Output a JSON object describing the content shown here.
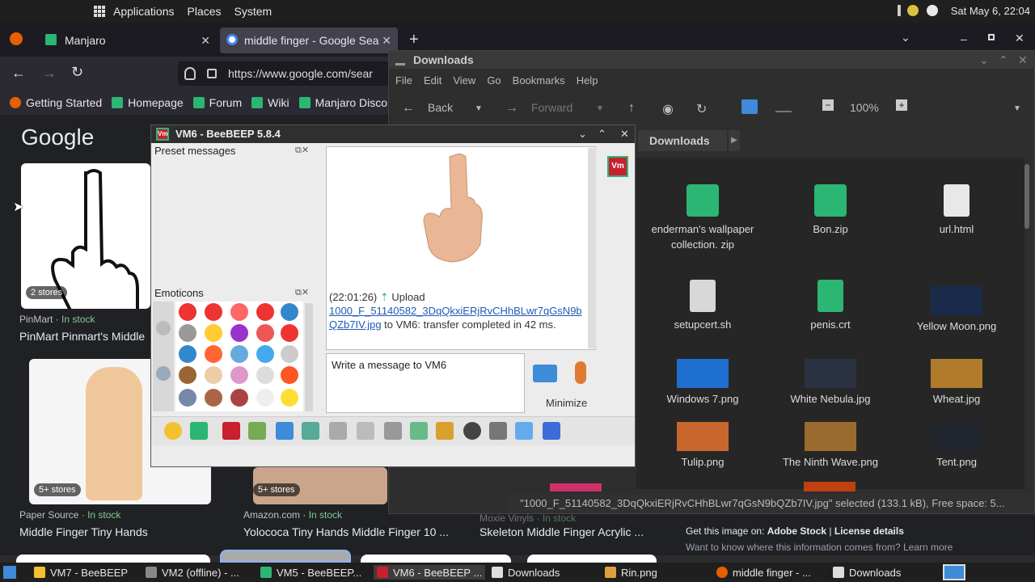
{
  "top_panel": {
    "menus": [
      "Applications",
      "Places",
      "System"
    ],
    "clock": "Sat May 6, 22:04"
  },
  "firefox": {
    "tabs": [
      {
        "label": "Manjaro"
      },
      {
        "label": "middle finger - Google Sea"
      }
    ],
    "url": "https://www.google.com/sear",
    "bookmarks": [
      "Getting Started",
      "Homepage",
      "Forum",
      "Wiki",
      "Manjaro Disco"
    ],
    "google_logo": "Google",
    "results": [
      {
        "stores": "2 stores",
        "source": "PinMart",
        "stock": "In stock",
        "title": "PinMart Pinmart's Middle"
      },
      {
        "stores": "5+ stores",
        "source": "Paper Source",
        "stock": "In stock",
        "title": "Middle Finger Tiny Hands"
      },
      {
        "stores": "5+ stores",
        "source": "Amazon.com",
        "stock": "In stock",
        "title": "Yolococa Tiny Hands Middle Finger 10 ..."
      },
      {
        "source": "Moxie Vinyls",
        "stock": "In stock",
        "title": "Skeleton Middle Finger Acrylic ..."
      }
    ],
    "adobe_line": {
      "prefix": "Get this image on: ",
      "adobe": "Adobe Stock",
      "sep": " | ",
      "license": "License details"
    },
    "adobe_line2": "Want to know where this information comes from? Learn more"
  },
  "downloads": {
    "title": "Downloads",
    "menus": [
      "File",
      "Edit",
      "View",
      "Go",
      "Bookmarks",
      "Help"
    ],
    "back": "Back",
    "forward": "Forward",
    "zoom": "100%",
    "path": "Downloads",
    "files": [
      {
        "name": "enderman's wallpaper collection. zip",
        "kind": "zip"
      },
      {
        "name": "Bon.zip",
        "kind": "zip"
      },
      {
        "name": "url.html",
        "kind": "doc"
      },
      {
        "name": "setupcert.sh",
        "kind": "script"
      },
      {
        "name": "penis.crt",
        "kind": "cert"
      },
      {
        "name": "Yellow Moon.png",
        "kind": "img",
        "color": "#1a2a4a"
      },
      {
        "name": "Windows 7.png",
        "kind": "img",
        "color": "#1e6fd0"
      },
      {
        "name": "White Nebula.jpg",
        "kind": "img",
        "color": "#2b3342"
      },
      {
        "name": "Wheat.jpg",
        "kind": "img",
        "color": "#b07b2a"
      },
      {
        "name": "Tulip.png",
        "kind": "img",
        "color": "#c9662d"
      },
      {
        "name": "The Ninth Wave.png",
        "kind": "img",
        "color": "#9a6a2e"
      },
      {
        "name": "Tent.png",
        "kind": "img",
        "color": "#20252e"
      }
    ],
    "status": "\"1000_F_51140582_3DqQkxiERjRvCHhBLwr7qGsN9bQZb7IV.jpg\" selected (133.1 kB), Free space: 5..."
  },
  "beebeep": {
    "title": "VM6 - BeeBEEP 5.8.4",
    "badge": "Vm",
    "preset_label": "Preset messages",
    "emoticons_label": "Emoticons",
    "chat": {
      "time": "(22:01:26)",
      "action": "Upload",
      "link": "1000_F_51140582_3DqQkxiERjRvCHhBLwr7qGsN9bQZb7IV.jpg",
      "suffix": " to VM6: transfer completed in 42 ms."
    },
    "input_placeholder": "Write a message to VM6",
    "minimize": "Minimize"
  },
  "taskbar": {
    "items": [
      {
        "label": "VM7 - BeeBEEP",
        "color": "#f2c12e"
      },
      {
        "label": "VM2 (offline) - ...",
        "color": "#888888"
      },
      {
        "label": "VM5 - BeeBEEP...",
        "color": "#2bb673"
      },
      {
        "label": "VM6 - BeeBEEP ...",
        "color": "#c8202f"
      },
      {
        "label": "Downloads",
        "color": "#dddddd"
      },
      {
        "label": "Rin.png",
        "color": "#e0a040"
      },
      {
        "label": "middle finger - ...",
        "color": "#e66000"
      },
      {
        "label": "Downloads",
        "color": "#dddddd"
      }
    ]
  }
}
